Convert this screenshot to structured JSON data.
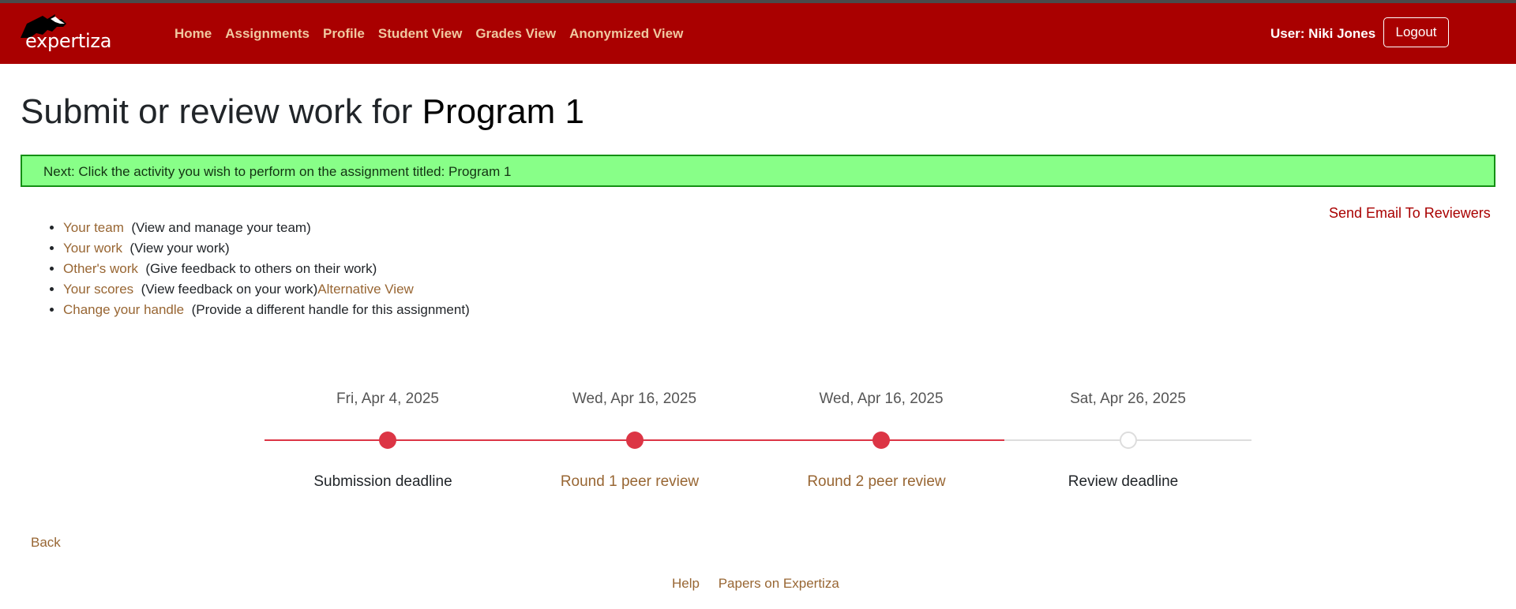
{
  "header": {
    "logo_text": "expertiza",
    "nav": [
      {
        "label": "Home"
      },
      {
        "label": "Assignments"
      },
      {
        "label": "Profile"
      },
      {
        "label": "Student View"
      },
      {
        "label": "Grades View"
      },
      {
        "label": "Anonymized View"
      }
    ],
    "user_label": "User: Niki Jones",
    "logout_label": "Logout"
  },
  "page": {
    "title_prefix": "Submit or review work for",
    "assignment_name": "Program 1",
    "flash_message": "Next: Click the activity you wish to perform on the assignment titled: Program 1",
    "send_email_label": "Send Email To Reviewers"
  },
  "activities": [
    {
      "link": "Your team",
      "desc": "(View and manage your team)"
    },
    {
      "link": "Your work",
      "desc": "(View your work)"
    },
    {
      "link": "Other's work",
      "desc": "(Give feedback to others on their work)"
    },
    {
      "link": "Your scores",
      "desc": "(View feedback on your work)",
      "extra_link": "Alternative View"
    },
    {
      "link": "Change your handle",
      "desc": "(Provide a different handle for this assignment)"
    }
  ],
  "timeline": {
    "active_color": "#dc3545",
    "inactive_color": "#dddddd",
    "label_link_color": "#986633",
    "items": [
      {
        "date": "Fri, Apr 4, 2025",
        "label": "Submission deadline",
        "status": "past",
        "is_link": false
      },
      {
        "date": "Wed, Apr 16, 2025",
        "label": "Round 1 peer review",
        "status": "past",
        "is_link": true
      },
      {
        "date": "Wed, Apr 16, 2025",
        "label": "Round 2 peer review",
        "status": "past",
        "is_link": true
      },
      {
        "date": "Sat, Apr 26, 2025",
        "label": "Review deadline",
        "status": "upcoming",
        "is_link": false
      }
    ]
  },
  "footer": {
    "back_label": "Back",
    "links": [
      {
        "label": "Help"
      },
      {
        "label": "Papers on Expertiza"
      }
    ]
  },
  "colors": {
    "navbar": "#a90000",
    "nav_link": "#f0c8a0",
    "link": "#986633",
    "flash_bg": "#88ff88",
    "flash_border": "#138f13",
    "email_link": "#a90000"
  }
}
